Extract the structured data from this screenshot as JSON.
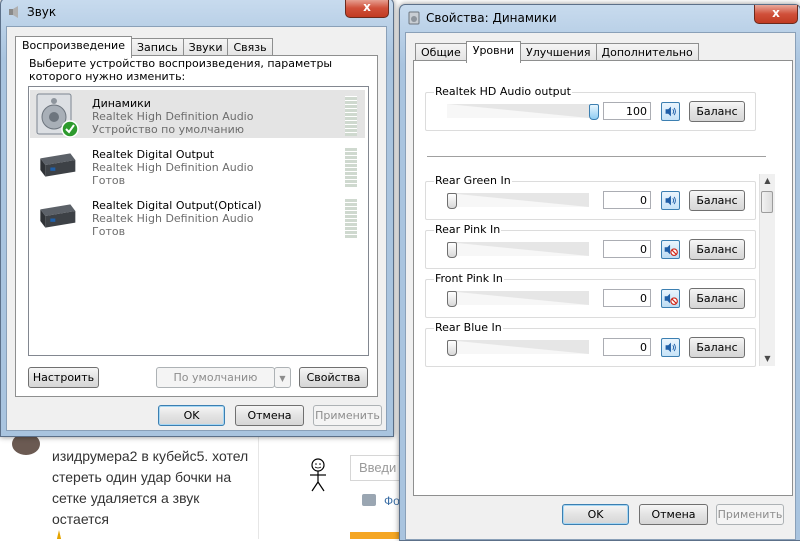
{
  "background_page": {
    "comment_text": "изидрумера2 в кубейс5. хотел стереть один удар бочки на сетке удаляется а звук остается",
    "input_placeholder": "Введи",
    "photo_label": "Фо"
  },
  "sound_dialog": {
    "title": "Звук",
    "close_label": "x",
    "tabs": [
      "Воспроизведение",
      "Запись",
      "Звуки",
      "Связь"
    ],
    "prompt": "Выберите устройство воспроизведения, параметры которого нужно изменить:",
    "devices": [
      {
        "name": "Динамики",
        "driver": "Realtek High Definition Audio",
        "status": "Устройство по умолчанию",
        "icon": "speaker-icon",
        "default": true
      },
      {
        "name": "Realtek Digital Output",
        "driver": "Realtek High Definition Audio",
        "status": "Готов",
        "icon": "digital-output-icon",
        "default": false
      },
      {
        "name": "Realtek Digital Output(Optical)",
        "driver": "Realtek High Definition Audio",
        "status": "Готов",
        "icon": "digital-output-icon",
        "default": false
      }
    ],
    "buttons": {
      "configure": "Настроить",
      "set_default": "По умолчанию",
      "properties": "Свойства",
      "ok": "OK",
      "cancel": "Отмена",
      "apply": "Применить"
    }
  },
  "properties_dialog": {
    "title": "Свойства: Динамики",
    "close_label": "x",
    "tabs": [
      "Общие",
      "Уровни",
      "Улучшения",
      "Дополнительно"
    ],
    "active_tab": "Уровни",
    "main_level": {
      "label": "Realtek HD Audio output",
      "value": "100",
      "level": 1.0,
      "muted": false
    },
    "levels": [
      {
        "label": "Rear Green In",
        "value": "0",
        "level": 0.0,
        "muted": false
      },
      {
        "label": "Rear Pink In",
        "value": "0",
        "level": 0.0,
        "muted": true
      },
      {
        "label": "Front Pink In",
        "value": "0",
        "level": 0.0,
        "muted": true
      },
      {
        "label": "Rear Blue In",
        "value": "0",
        "level": 0.0,
        "muted": false
      }
    ],
    "balance_label": "Баланс",
    "buttons": {
      "ok": "OK",
      "cancel": "Отмена",
      "apply": "Применить"
    }
  }
}
